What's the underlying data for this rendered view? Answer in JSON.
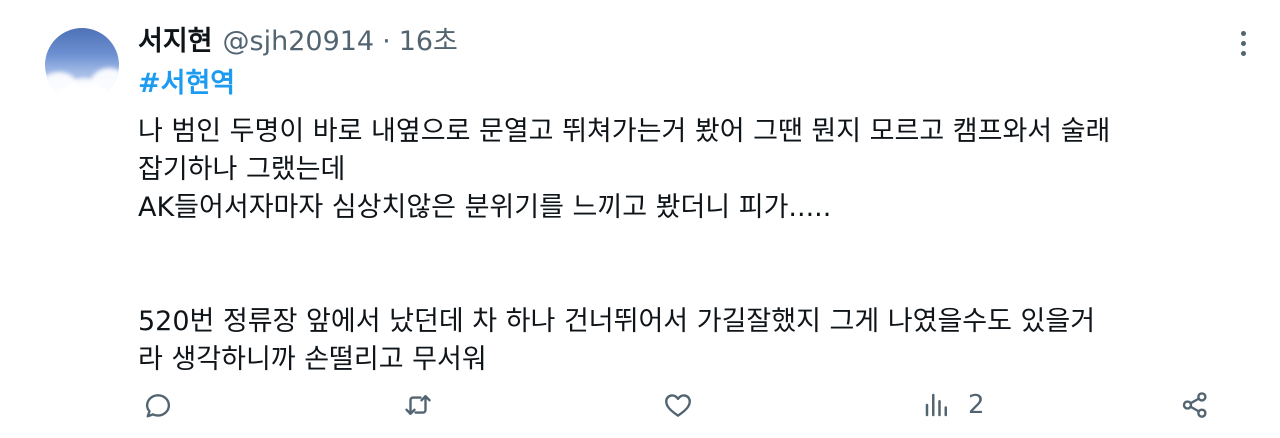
{
  "tweet": {
    "display_name": "서지현",
    "handle": "@sjh20914",
    "separator": "·",
    "time": "16초",
    "hashtag": "#서현역",
    "lines": [
      "나 범인 두명이 바로 내옆으로 문열고 뛰쳐가는거 봤어 그땐 뭔지 모르고 캠프와서 술래",
      "잡기하나 그랬는데",
      "AK들어서자마자 심상치않은 분위기를 느끼고 봤더니 피가.....",
      "520번 정류장 앞에서 났던데 차 하나 건너뛰어서 가길잘했지 그게 나였을수도 있을거",
      "라 생각하니까 손떨리고 무서워"
    ]
  },
  "actions": {
    "reply_icon": "reply-icon",
    "retweet_icon": "retweet-icon",
    "like_icon": "heart-icon",
    "views_icon": "views-icon",
    "views_count": "2",
    "share_icon": "share-icon"
  },
  "colors": {
    "text": "#0f1419",
    "secondary": "#536471",
    "hashtag": "#1d9bf0"
  }
}
